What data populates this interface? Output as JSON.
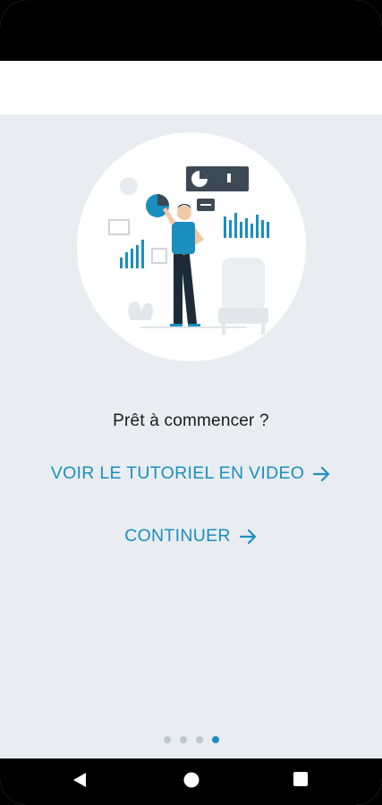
{
  "onboarding": {
    "prompt": "Prêt à commencer ?",
    "video_link_label": "VOIR LE TUTORIEL EN VIDEO",
    "continue_label": "CONTINUER",
    "pages_total": 4,
    "active_page": 4
  },
  "icons": {
    "link_arrow": "arrow-right-icon",
    "nav_back": "back-triangle-icon",
    "nav_home": "home-circle-icon",
    "nav_recent": "recent-square-icon"
  },
  "colors": {
    "accent": "#1a8fbf",
    "background": "#e9edf1",
    "header": "#ffffff",
    "dot_inactive": "#bfc4c9"
  }
}
